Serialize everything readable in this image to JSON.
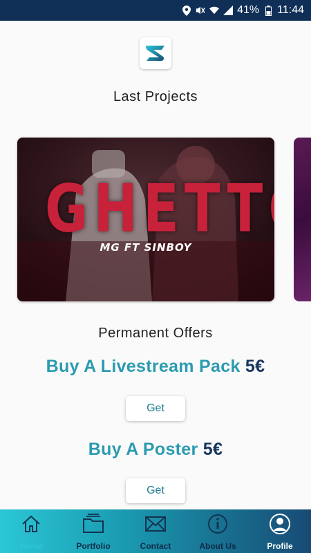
{
  "status_bar": {
    "battery": "41%",
    "time": "11:44",
    "icons": [
      "location-icon",
      "mute-icon",
      "wifi-icon",
      "signal-icon",
      "battery-icon"
    ]
  },
  "home": {
    "last_projects_title": "Last Projects",
    "projects": [
      {
        "title": "GHETTO",
        "subtitle": "MG FT SINBOY"
      }
    ],
    "permanent_offers_title": "Permanent Offers",
    "offers": [
      {
        "label": "Buy A Livestream Pack",
        "price": "5€",
        "button": "Get"
      },
      {
        "label": "Buy A Poster",
        "price": "5€",
        "button": "Get"
      }
    ]
  },
  "nav": {
    "items": [
      {
        "label": "Home",
        "icon": "home-icon"
      },
      {
        "label": "Portfolio",
        "icon": "folder-icon"
      },
      {
        "label": "Contact",
        "icon": "mail-icon"
      },
      {
        "label": "About Us",
        "icon": "info-icon"
      },
      {
        "label": "Profile",
        "icon": "profile-icon"
      }
    ]
  },
  "colors": {
    "status_bar": "#0f2f57",
    "offer_accent": "#2b9bb0",
    "price": "#17365f",
    "nav_start": "#2bc7d6",
    "nav_end": "#174a74"
  }
}
